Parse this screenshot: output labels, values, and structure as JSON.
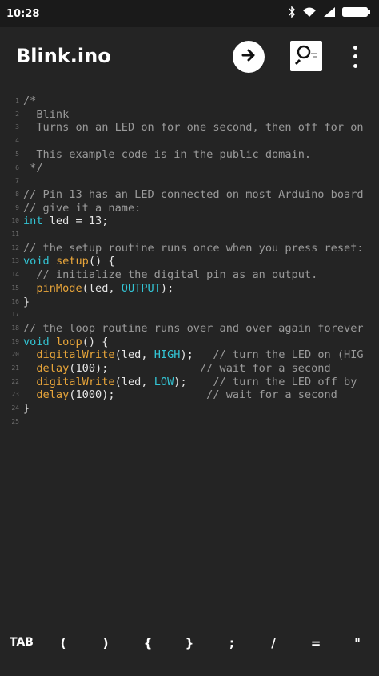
{
  "status_bar": {
    "time": "10:28",
    "icons": [
      "bluetooth-icon",
      "wifi-icon",
      "signal-icon",
      "battery-icon"
    ]
  },
  "app_bar": {
    "title": "Blink.ino",
    "actions": [
      "run-arrow-icon",
      "search-icon",
      "more-vert-icon"
    ]
  },
  "editor": {
    "lines": [
      {
        "n": "1",
        "segments": [
          {
            "t": "/*",
            "c": "comment"
          }
        ]
      },
      {
        "n": "2",
        "segments": [
          {
            "t": "  Blink",
            "c": "comment"
          }
        ]
      },
      {
        "n": "3",
        "segments": [
          {
            "t": "  Turns on an LED on for one second, then off for on",
            "c": "comment"
          }
        ]
      },
      {
        "n": "4",
        "segments": [
          {
            "t": "",
            "c": "plain"
          }
        ]
      },
      {
        "n": "5",
        "segments": [
          {
            "t": "  This example code is in the public domain.",
            "c": "comment"
          }
        ]
      },
      {
        "n": "6",
        "segments": [
          {
            "t": " */",
            "c": "comment"
          }
        ]
      },
      {
        "n": "7",
        "segments": [
          {
            "t": "",
            "c": "plain"
          }
        ]
      },
      {
        "n": "8",
        "segments": [
          {
            "t": "// Pin 13 has an LED connected on most Arduino board",
            "c": "comment"
          }
        ]
      },
      {
        "n": "9",
        "segments": [
          {
            "t": "// give it a name:",
            "c": "comment"
          }
        ]
      },
      {
        "n": "10",
        "segments": [
          {
            "t": "int",
            "c": "type"
          },
          {
            "t": " led = 13;",
            "c": "plain"
          }
        ]
      },
      {
        "n": "11",
        "segments": [
          {
            "t": "",
            "c": "plain"
          }
        ]
      },
      {
        "n": "12",
        "segments": [
          {
            "t": "// the setup routine runs once when you press reset:",
            "c": "comment"
          }
        ]
      },
      {
        "n": "13",
        "segments": [
          {
            "t": "void",
            "c": "type"
          },
          {
            "t": " ",
            "c": "plain"
          },
          {
            "t": "setup",
            "c": "func"
          },
          {
            "t": "() {",
            "c": "plain"
          }
        ]
      },
      {
        "n": "14",
        "segments": [
          {
            "t": "  // initialize the digital pin as an output.",
            "c": "comment"
          }
        ]
      },
      {
        "n": "15",
        "segments": [
          {
            "t": "  ",
            "c": "plain"
          },
          {
            "t": "pinMode",
            "c": "func"
          },
          {
            "t": "(led, ",
            "c": "plain"
          },
          {
            "t": "OUTPUT",
            "c": "const"
          },
          {
            "t": ");",
            "c": "plain"
          }
        ]
      },
      {
        "n": "16",
        "segments": [
          {
            "t": "}",
            "c": "plain"
          }
        ]
      },
      {
        "n": "17",
        "segments": [
          {
            "t": "",
            "c": "plain"
          }
        ]
      },
      {
        "n": "18",
        "segments": [
          {
            "t": "// the loop routine runs over and over again forever",
            "c": "comment"
          }
        ]
      },
      {
        "n": "19",
        "segments": [
          {
            "t": "void",
            "c": "type"
          },
          {
            "t": " ",
            "c": "plain"
          },
          {
            "t": "loop",
            "c": "func"
          },
          {
            "t": "() {",
            "c": "plain"
          }
        ]
      },
      {
        "n": "20",
        "segments": [
          {
            "t": "  ",
            "c": "plain"
          },
          {
            "t": "digitalWrite",
            "c": "func"
          },
          {
            "t": "(led, ",
            "c": "plain"
          },
          {
            "t": "HIGH",
            "c": "const"
          },
          {
            "t": ");   ",
            "c": "plain"
          },
          {
            "t": "// turn the LED on (HIG",
            "c": "comment"
          }
        ]
      },
      {
        "n": "21",
        "segments": [
          {
            "t": "  ",
            "c": "plain"
          },
          {
            "t": "delay",
            "c": "func"
          },
          {
            "t": "(100);              ",
            "c": "plain"
          },
          {
            "t": "// wait for a second",
            "c": "comment"
          }
        ]
      },
      {
        "n": "22",
        "segments": [
          {
            "t": "  ",
            "c": "plain"
          },
          {
            "t": "digitalWrite",
            "c": "func"
          },
          {
            "t": "(led, ",
            "c": "plain"
          },
          {
            "t": "LOW",
            "c": "const"
          },
          {
            "t": ");    ",
            "c": "plain"
          },
          {
            "t": "// turn the LED off by",
            "c": "comment"
          }
        ]
      },
      {
        "n": "23",
        "segments": [
          {
            "t": "  ",
            "c": "plain"
          },
          {
            "t": "delay",
            "c": "func"
          },
          {
            "t": "(1000);              ",
            "c": "plain"
          },
          {
            "t": "// wait for a second",
            "c": "comment"
          }
        ]
      },
      {
        "n": "24",
        "segments": [
          {
            "t": "}",
            "c": "plain"
          }
        ]
      },
      {
        "n": "25",
        "segments": [
          {
            "t": "",
            "c": "plain"
          }
        ]
      }
    ]
  },
  "key_bar": {
    "keys": [
      {
        "name": "tab",
        "label": "TAB"
      },
      {
        "name": "open-paren",
        "label": "("
      },
      {
        "name": "close-paren",
        "label": ")"
      },
      {
        "name": "open-brace",
        "label": "{"
      },
      {
        "name": "close-brace",
        "label": "}"
      },
      {
        "name": "semicolon",
        "label": ";"
      },
      {
        "name": "slash",
        "label": "/"
      },
      {
        "name": "equals",
        "label": "="
      },
      {
        "name": "double-quote",
        "label": "\""
      }
    ]
  },
  "colors": {
    "background": "#242424",
    "comment": "#9a9a9a",
    "type": "#33c4d4",
    "function": "#e8a53a",
    "constant": "#33c4d4",
    "text": "#e6e6e6"
  }
}
